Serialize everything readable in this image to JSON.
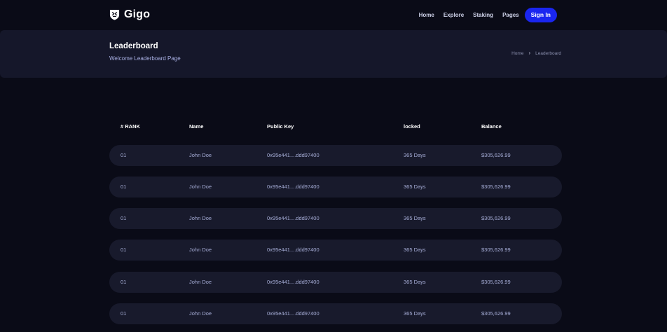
{
  "brand": {
    "name": "Gigo"
  },
  "nav": {
    "items": [
      "Home",
      "Explore",
      "Staking",
      "Pages"
    ],
    "signin_label": "Sign In"
  },
  "banner": {
    "title": "Leaderboard",
    "subtitle": "Welcome Leaderboard Page",
    "breadcrumb": [
      "Home",
      "Leaderboard"
    ]
  },
  "table": {
    "columns": [
      "# RANK",
      "Name",
      "Public Key",
      "locked",
      "Balance"
    ],
    "rows": [
      [
        "01",
        "John Doe",
        "0x95e441....ddd97400",
        "365 Days",
        "$305,626.99"
      ],
      [
        "01",
        "John Doe",
        "0x95e441....ddd97400",
        "365 Days",
        "$305,626.99"
      ],
      [
        "01",
        "John Doe",
        "0x95e441....ddd97400",
        "365 Days",
        "$305,626.99"
      ],
      [
        "01",
        "John Doe",
        "0x95e441....ddd97400",
        "365 Days",
        "$305,626.99"
      ],
      [
        "01",
        "John Doe",
        "0x95e441....ddd97400",
        "365 Days",
        "$305,626.99"
      ],
      [
        "01",
        "John Doe",
        "0x95e441....ddd97400",
        "365 Days",
        "$305,626.99"
      ]
    ]
  },
  "colors": {
    "background": "#0a0b17",
    "banner": "#15172a",
    "row": "#181a2c",
    "accent": "#1a26f0",
    "muted_text": "#a7aed8"
  }
}
